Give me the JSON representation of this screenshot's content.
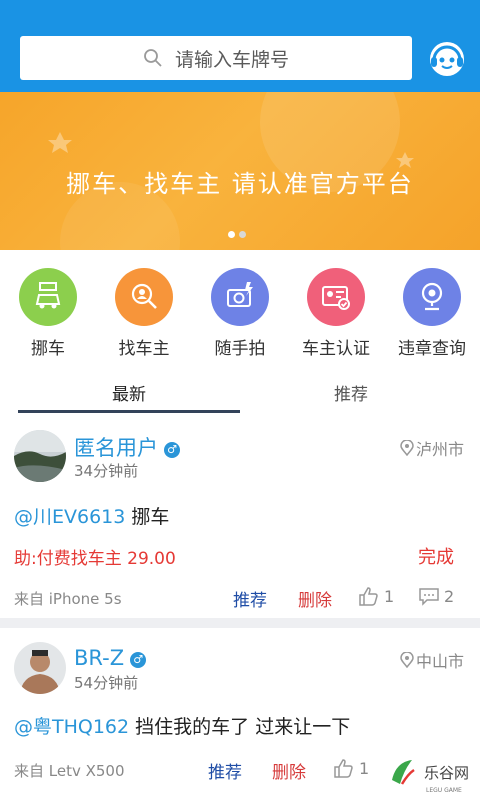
{
  "search": {
    "placeholder": "请输入车牌号"
  },
  "banner": {
    "title": "挪车、找车主  请认准官方平台",
    "slide_count": 2,
    "active_slide": 1
  },
  "features": [
    {
      "label": "挪车",
      "icon": "move-car-icon",
      "color": "#8ccf4d"
    },
    {
      "label": "找车主",
      "icon": "find-owner-icon",
      "color": "#f7953a"
    },
    {
      "label": "随手拍",
      "icon": "camera-icon",
      "color": "#6e82e6"
    },
    {
      "label": "车主认证",
      "icon": "id-card-icon",
      "color": "#f0607a"
    },
    {
      "label": "违章查询",
      "icon": "webcam-icon",
      "color": "#6e82e6"
    }
  ],
  "tabs": [
    {
      "label": "最新",
      "active": true
    },
    {
      "label": "推荐",
      "active": false
    }
  ],
  "posts": [
    {
      "user": "匿名用户",
      "time": "34分钟前",
      "location": "泸州市",
      "plate": "@川EV6613",
      "text": " 挪车",
      "paid": "助:付费找车主 29.00",
      "status": "完成",
      "from": "来自  iPhone 5s",
      "recommend": "推荐",
      "delete": "删除",
      "likes": "1",
      "comments": "2"
    },
    {
      "user": "BR-Z",
      "time": "54分钟前",
      "location": "中山市",
      "plate": "@粤THQ162",
      "text": " 挡住我的车了 过来让一下",
      "from": "来自  Letv X500",
      "recommend": "推荐",
      "delete": "删除",
      "likes": "1"
    }
  ],
  "watermark": {
    "text": "乐谷网"
  },
  "colors": {
    "brand_blue": "#1a93e4",
    "banner_orange": "#f7a832",
    "link_blue": "#2a95d8",
    "alert_red": "#e53935"
  }
}
